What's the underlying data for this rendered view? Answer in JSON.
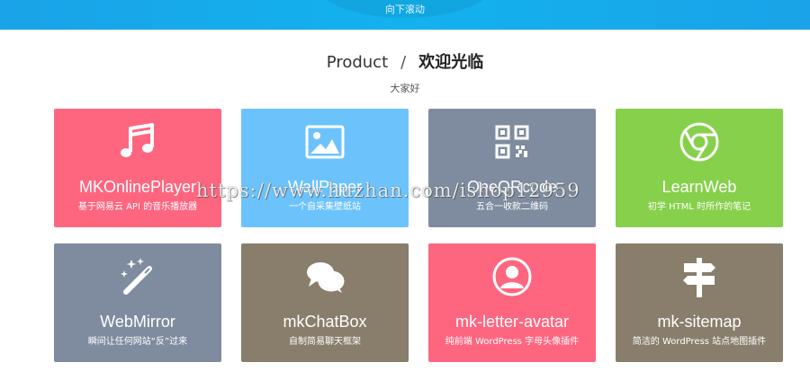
{
  "header": {
    "scroll_hint": "向下滚动"
  },
  "section": {
    "title_en": "Product",
    "separator": "/",
    "title_cn": "欢迎光临",
    "subtitle": "大家好"
  },
  "cards": [
    {
      "title": "MKOnlinePlayer",
      "desc": "基于网易云 API 的音乐播放器",
      "icon": "music-note-icon",
      "color": "#fe6680"
    },
    {
      "title": "WallPaper",
      "desc": "一个自采集壁纸站",
      "icon": "image-icon",
      "color": "#6cc3fc"
    },
    {
      "title": "OneQRcode",
      "desc": "五合一收款二维码",
      "icon": "qrcode-icon",
      "color": "#7f8c9f"
    },
    {
      "title": "LearnWeb",
      "desc": "初学 HTML 时所作的笔记",
      "icon": "chrome-icon",
      "color": "#86d04b"
    },
    {
      "title": "WebMirror",
      "desc": "瞬间让任何网站“反”过来",
      "icon": "magic-wand-icon",
      "color": "#7f8c9f"
    },
    {
      "title": "mkChatBox",
      "desc": "自制简易聊天框架",
      "icon": "chat-bubbles-icon",
      "color": "#887e6b"
    },
    {
      "title": "mk-letter-avatar",
      "desc": "纯前端 WordPress 字母头像插件",
      "icon": "user-avatar-icon",
      "color": "#fe6680"
    },
    {
      "title": "mk-sitemap",
      "desc": "简洁的 WordPress 站点地图插件",
      "icon": "signpost-icon",
      "color": "#887e6b"
    }
  ],
  "watermark": "https://www.huzhan.com/ishop12959"
}
